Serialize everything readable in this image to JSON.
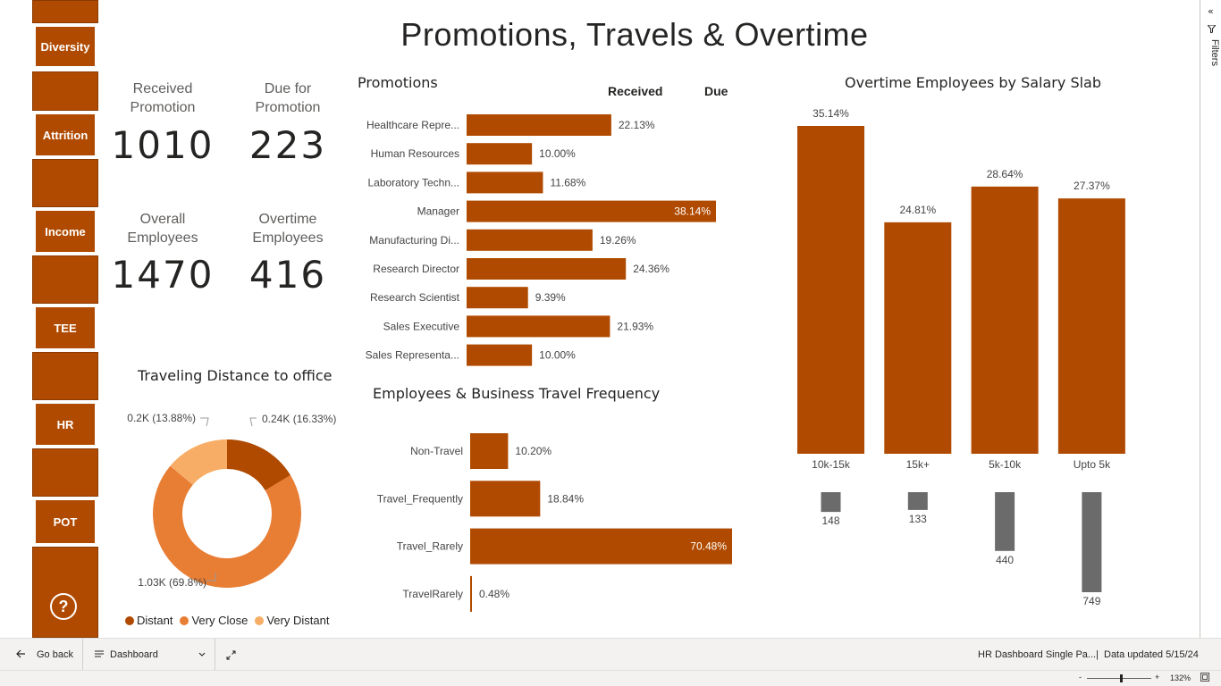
{
  "title": "Promotions, Travels & Overtime",
  "nav": {
    "buttons": [
      {
        "label": "Diversity"
      },
      {
        "label": "Attrition"
      },
      {
        "label": "Income"
      },
      {
        "label": "TEE"
      },
      {
        "label": "HR"
      },
      {
        "label": "POT"
      }
    ],
    "help_symbol": "?"
  },
  "kpis": [
    {
      "label_line1": "Received",
      "label_line2": "Promotion",
      "value": "1010"
    },
    {
      "label_line1": "Due for",
      "label_line2": "Promotion",
      "value": "223"
    },
    {
      "label_line1": "Overall",
      "label_line2": "Employees",
      "value": "1470"
    },
    {
      "label_line1": "Overtime",
      "label_line2": "Employees",
      "value": "416"
    }
  ],
  "colors": {
    "primary": "#b04a00",
    "medium": "#e87d34",
    "light": "#f8ad66",
    "gray": "#6b6b6b"
  },
  "promotions": {
    "title": "Promotions",
    "col_received": "Received",
    "col_due": "Due"
  },
  "travel_freq_title": "Employees & Business Travel Frequency",
  "overtime_title": "Overtime Employees by Salary Slab",
  "distance_title": "Traveling Distance to office",
  "chart_data": [
    {
      "type": "bar",
      "orientation": "horizontal",
      "title": "Promotions",
      "categories": [
        "Healthcare Repre...",
        "Human Resources",
        "Laboratory Techn...",
        "Manager",
        "Manufacturing Di...",
        "Research Director",
        "Research Scientist",
        "Sales Executive",
        "Sales Representa..."
      ],
      "values": [
        22.13,
        10.0,
        11.68,
        38.14,
        19.26,
        24.36,
        9.39,
        21.93,
        10.0
      ],
      "labels": [
        "22.13%",
        "10.00%",
        "11.68%",
        "38.14%",
        "19.26%",
        "24.36%",
        "9.39%",
        "21.93%",
        "10.00%"
      ]
    },
    {
      "type": "bar",
      "orientation": "horizontal",
      "title": "Employees & Business Travel Frequency",
      "categories": [
        "Non-Travel",
        "Travel_Frequently",
        "Travel_Rarely",
        "TravelRarely"
      ],
      "values": [
        10.2,
        18.84,
        70.48,
        0.48
      ],
      "labels": [
        "10.20%",
        "18.84%",
        "70.48%",
        "0.48%"
      ]
    },
    {
      "type": "bar",
      "title": "Overtime Employees by Salary Slab",
      "categories": [
        "10k-15k",
        "15k+",
        "5k-10k",
        "Upto 5k"
      ],
      "values": [
        35.14,
        24.81,
        28.64,
        27.37
      ],
      "labels": [
        "35.14%",
        "24.81%",
        "28.64%",
        "27.37%"
      ]
    },
    {
      "type": "bar",
      "categories": [
        "10k-15k",
        "15k+",
        "5k-10k",
        "Upto 5k"
      ],
      "values": [
        148,
        133,
        440,
        749
      ],
      "labels": [
        "148",
        "133",
        "440",
        "749"
      ]
    },
    {
      "type": "pie",
      "variant": "donut",
      "title": "Traveling Distance to office",
      "categories": [
        "Distant",
        "Very Close",
        "Very Distant"
      ],
      "values": [
        16.33,
        69.8,
        13.88
      ],
      "labels": [
        "0.24K (16.33%)",
        "1.03K (69.8%)",
        "0.2K (13.88%)"
      ]
    }
  ],
  "filters": {
    "label": "Filters",
    "collapse": "«"
  },
  "bottom_bar": {
    "go_back": "Go back",
    "page_name": "Dashboard",
    "report_name": "HR Dashboard Single Pa...",
    "data_updated": "Data updated 5/15/24",
    "zoom": "132%",
    "zoom_minus": "-",
    "zoom_plus": "+"
  }
}
